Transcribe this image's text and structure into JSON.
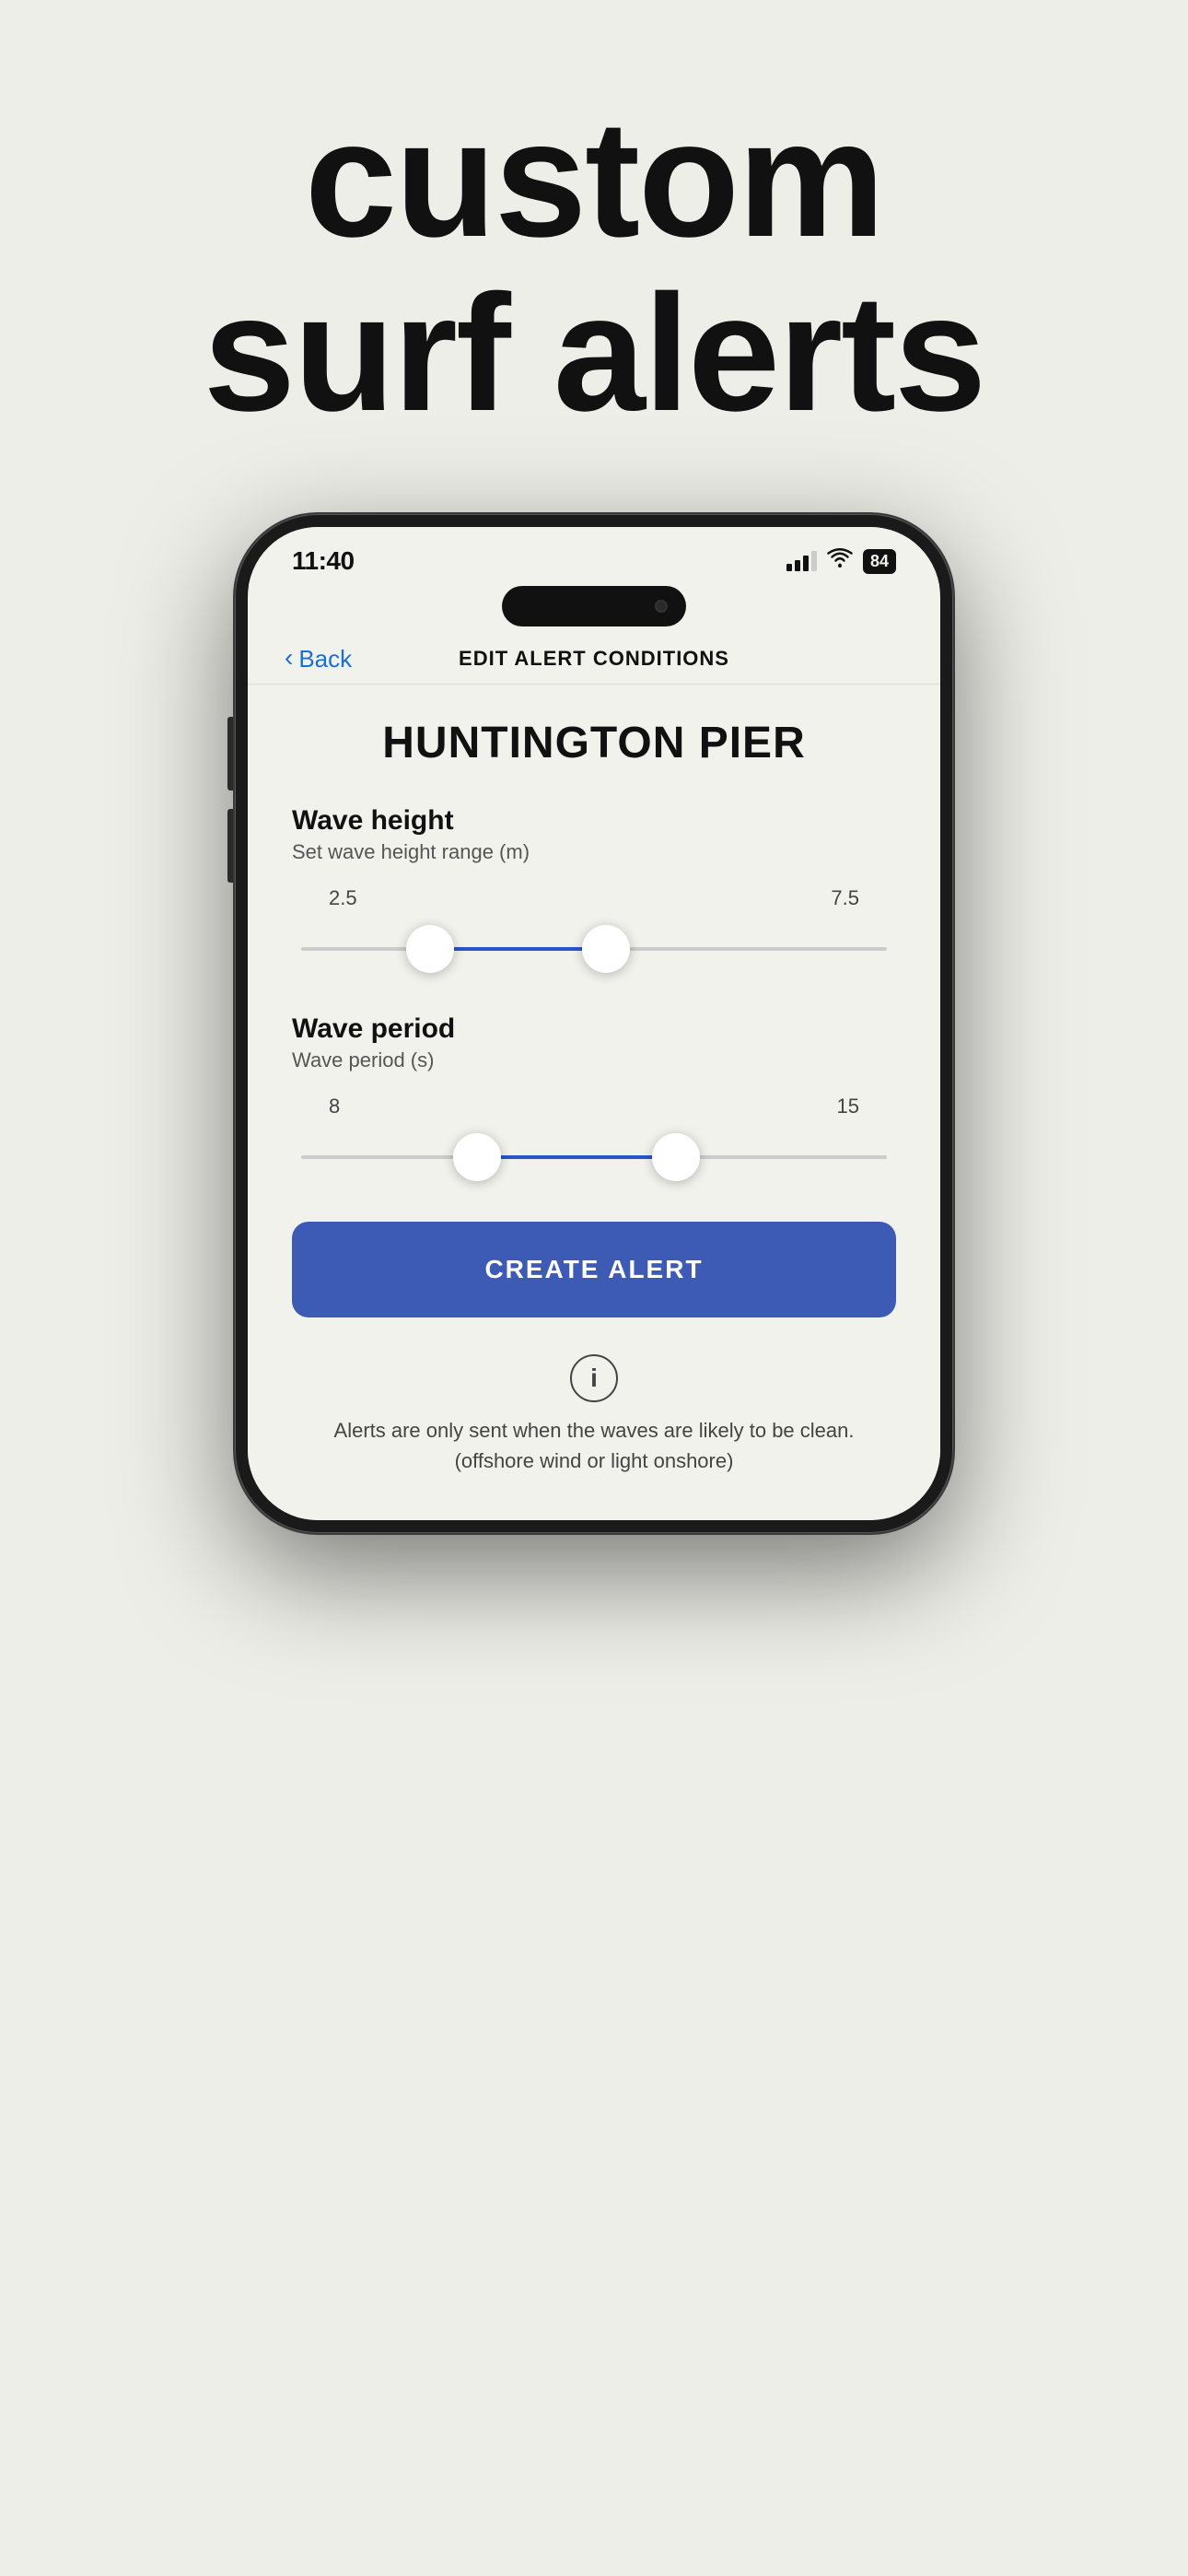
{
  "hero": {
    "line1": "custom",
    "line2": "surf alerts"
  },
  "phone": {
    "statusBar": {
      "time": "11:40",
      "battery": "84"
    },
    "nav": {
      "backLabel": "Back",
      "title": "EDIT ALERT CONDITIONS"
    },
    "content": {
      "locationName": "HUNTINGTON PIER",
      "waveHeight": {
        "title": "Wave height",
        "subtitle": "Set wave height range (m)",
        "minValue": "2.5",
        "maxValue": "7.5",
        "minPercent": 22,
        "maxPercent": 52
      },
      "wavePeriod": {
        "title": "Wave period",
        "subtitle": "Wave period (s)",
        "minValue": "8",
        "maxValue": "15",
        "minPercent": 30,
        "maxPercent": 64
      },
      "createAlertLabel": "CREATE ALERT",
      "infoText": "Alerts are only sent when the waves are likely to be clean. (offshore wind or light onshore)"
    }
  }
}
